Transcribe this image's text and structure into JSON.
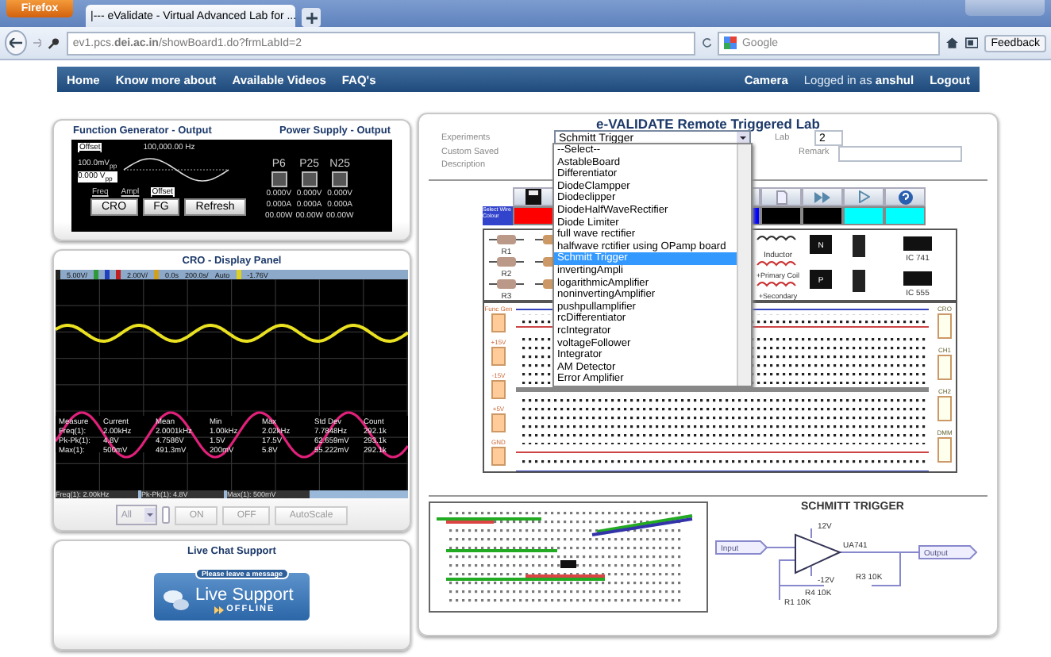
{
  "browser": {
    "firefox_button": "Firefox",
    "tab_title": "|--- eValidate - Virtual Advanced Lab for ...",
    "url": "ev1.pcs.**dei.ac.in**/showBoard1.do?frmLabId=2",
    "search": {
      "placeholder": "Google"
    },
    "feedback": "Feedback"
  },
  "nav": {
    "left": [
      "Home",
      "Know more about",
      "Available Videos",
      "FAQ's"
    ],
    "right": [
      "Camera"
    ],
    "login": "Logged in as **anshul**",
    "logout": "Logout"
  },
  "function_generator": {
    "title": "Function Generator - Output",
    "offset_tag": "Offset",
    "amplitude": "100.0mV$_{pp}$",
    "offset_value": "0.000 V$_{pp}$",
    "frequency": "100,000.00 Hz",
    "tabs": [
      {
        "label": "Freq",
        "selected": false
      },
      {
        "label": "Ampl",
        "selected": false
      },
      {
        "label": "Offset",
        "selected": true
      }
    ],
    "buttons": [
      "CRO",
      "FG",
      "Refresh"
    ]
  },
  "power_supply": {
    "title": "Power Supply - Output",
    "channels": [
      {
        "name": "P6",
        "voltage": "0.000V",
        "current": "0.000A",
        "power": "00.00W"
      },
      {
        "name": "P25",
        "voltage": "0.000V",
        "current": "0.000A",
        "power": "00.00W"
      },
      {
        "name": "N25",
        "voltage": "0.000V",
        "current": "0.000A",
        "power": "00.00W"
      }
    ]
  },
  "cro": {
    "title": "CRO - Display Panel",
    "header": [
      {
        "text": "5.00V/",
        "color": "#222222"
      },
      {
        "color": "#2e9a3a"
      },
      {
        "color": "#2040c0"
      },
      {
        "text": "2.00V/",
        "color": "#c02020"
      },
      {
        "text": "0.0s",
        "color": "#d0a020"
      },
      {
        "text": "200.0s/"
      },
      {
        "text": "Auto"
      },
      {
        "text": "-1.76V",
        "color": "#e0d020"
      }
    ],
    "measure_columns": [
      "Measure",
      "Current",
      "Mean",
      "Min",
      "Max",
      "Std Dev",
      "Count"
    ],
    "measure_rows": [
      [
        "Freq(1):",
        "2.00kHz",
        "2.0001kHz",
        "1.00kHz",
        "2.02kHz",
        "7.7848Hz",
        "292.1k"
      ],
      [
        "Pk-Pk(1):",
        "4.8V",
        "4.7586V",
        "1.5V",
        "17.5V",
        "62.659mV",
        "293.1k"
      ],
      [
        "Max(1):",
        "500mV",
        "491.3mV",
        "200mV",
        "5.8V",
        "55.222mV",
        "292.1k"
      ]
    ],
    "footer": [
      "Freq(1): 2.00kHz",
      "Pk-Pk(1): 4.8V",
      "Max(1): 500mV"
    ],
    "channel_select": "All",
    "buttons": [
      "ON",
      "OFF",
      "AutoScale"
    ]
  },
  "chat": {
    "title": "Live Chat Support",
    "banner_tag": "Please leave a message",
    "banner_main": "Live Support",
    "status": "OFFLINE"
  },
  "lab": {
    "title": "e-VALIDATE Remote Triggered Lab",
    "experiments_label": "Experiments",
    "experiment": "Schmitt Trigger",
    "lab_label": "Lab",
    "lab_value": "2",
    "description_label": "Custom Saved Description",
    "remark_label": "Remark",
    "dropdown": [
      {
        "label": "--Select--",
        "selected": false
      },
      {
        "label": "AstableBoard",
        "selected": false
      },
      {
        "label": "Differentiator",
        "selected": false
      },
      {
        "label": "DiodeClampper",
        "selected": false
      },
      {
        "label": "Diodeclipper",
        "selected": false
      },
      {
        "label": "DiodeHalfWaveRectifier",
        "selected": false
      },
      {
        "label": "Diode Limiter",
        "selected": false
      },
      {
        "label": "full wave rectifier",
        "selected": false
      },
      {
        "label": "halfwave rctifier using OPamp board",
        "selected": false
      },
      {
        "label": "Schmitt Trigger",
        "selected": true
      },
      {
        "label": "invertingAmpli",
        "selected": false
      },
      {
        "label": "logarithmicAmplifier",
        "selected": false
      },
      {
        "label": "noninvertingAmplifier",
        "selected": false
      },
      {
        "label": "pushpullamplifier",
        "selected": false
      },
      {
        "label": "rcDifferentiator",
        "selected": false
      },
      {
        "label": "rcIntegrator",
        "selected": false
      },
      {
        "label": "voltageFollower",
        "selected": false
      },
      {
        "label": "Integrator",
        "selected": false
      },
      {
        "label": "AM Detector",
        "selected": false
      },
      {
        "label": "Error Amplifier",
        "selected": false
      }
    ],
    "wire_label": "Select Wire Colour",
    "wire_colors": [
      {
        "color": "#ff0000"
      },
      {
        "color": "#0000ff"
      },
      {
        "color": "#000000"
      },
      {
        "color": "#000000"
      },
      {
        "color": "#00ffff"
      },
      {
        "color": "#00ffff"
      }
    ],
    "components": {
      "resistors": [
        "R1",
        "R2",
        "R3"
      ],
      "inductor": "Inductor",
      "primary": "+Primary Coil",
      "secondary": "+Secondary",
      "transistors": [
        "N",
        "P"
      ],
      "ics": [
        "IC 741",
        "IC 555"
      ]
    },
    "board_left": [
      "Func Gen",
      "+15V",
      "-15V",
      "+5V",
      "GND"
    ],
    "board_right": [
      "CRO",
      "CH1",
      "CH2",
      "DMM"
    ],
    "schematic": {
      "title": "SCHMITT TRIGGER",
      "input": "Input",
      "output": "Output",
      "vplus": "12V",
      "vminus": "-12V",
      "opamp": "UA741",
      "resistors": [
        "R1 10K",
        "R4 10K",
        "R3 10K"
      ]
    }
  }
}
